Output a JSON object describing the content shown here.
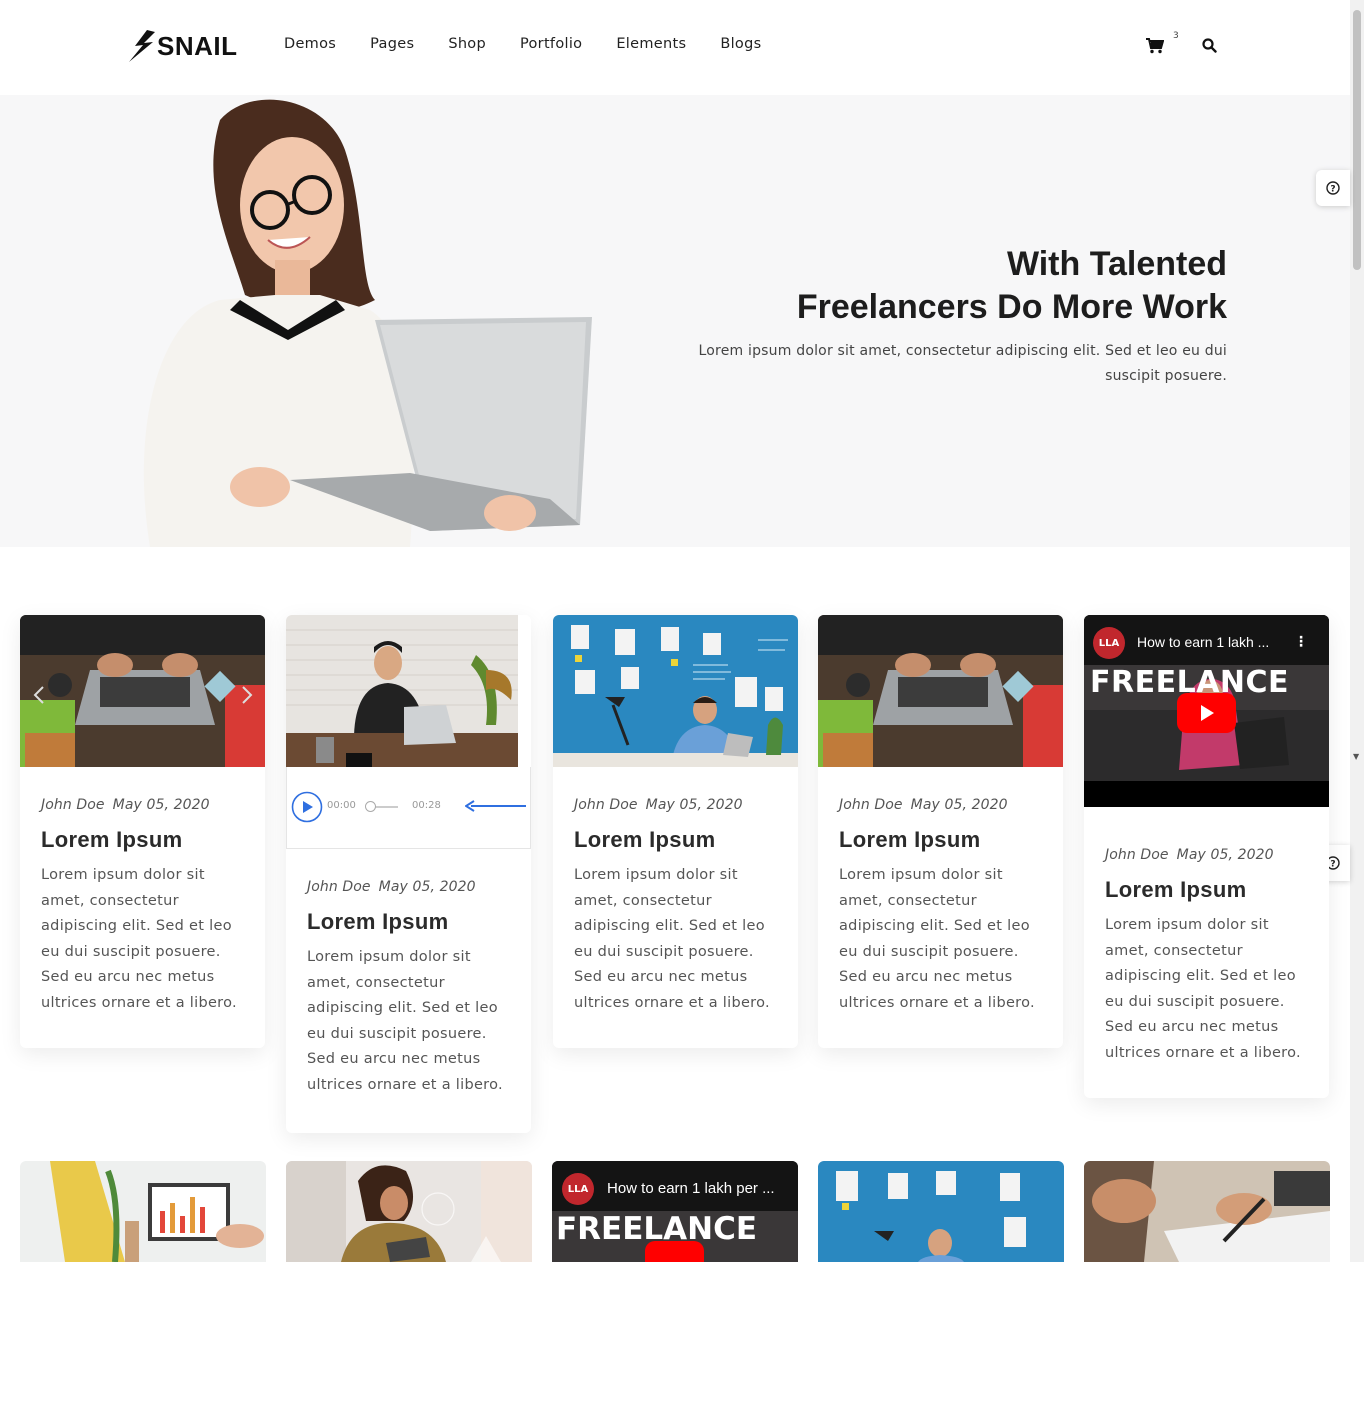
{
  "brand": {
    "logo_text": "SNAIL"
  },
  "nav": {
    "items": [
      {
        "label": "Demos"
      },
      {
        "label": "Pages"
      },
      {
        "label": "Shop"
      },
      {
        "label": "Portfolio"
      },
      {
        "label": "Elements"
      },
      {
        "label": "Blogs"
      }
    ],
    "cart_count": "3"
  },
  "hero": {
    "title_line1": "With Talented",
    "title_line2": "Freelancers Do More Work",
    "text": "Lorem ipsum dolor sit amet, consectetur adipiscing elit. Sed et leo eu dui suscipit posuere."
  },
  "cards": [
    {
      "author": "John Doe",
      "date": "May 05, 2020",
      "title": "Lorem Ipsum",
      "text": "Lorem ipsum dolor sit amet, consectetur adipiscing elit. Sed et leo eu dui suscipit posuere. Sed eu arcu nec metus ultrices ornare et a libero."
    },
    {
      "author": "John Doe",
      "date": "May 05, 2020",
      "title": "Lorem Ipsum",
      "text": "Lorem ipsum dolor sit amet, consectetur adipiscing elit. Sed et leo eu dui suscipit posuere. Sed eu arcu nec metus ultrices ornare et a libero."
    },
    {
      "author": "John Doe",
      "date": "May 05, 2020",
      "title": "Lorem Ipsum",
      "text": "Lorem ipsum dolor sit amet, consectetur adipiscing elit. Sed et leo eu dui suscipit posuere. Sed eu arcu nec metus ultrices ornare et a libero."
    },
    {
      "author": "John Doe",
      "date": "May 05, 2020",
      "title": "Lorem Ipsum",
      "text": "Lorem ipsum dolor sit amet, consectetur adipiscing elit. Sed et leo eu dui suscipit posuere. Sed eu arcu nec metus ultrices ornare et a libero."
    },
    {
      "author": "John Doe",
      "date": "May 05, 2020",
      "title": "Lorem Ipsum",
      "text": "Lorem ipsum dolor sit amet, consectetur adipiscing elit. Sed et leo eu dui suscipit posuere. Sed eu arcu nec metus ultrices ornare et a libero."
    }
  ],
  "audio": {
    "current_time": "00:00",
    "duration": "00:28"
  },
  "video": {
    "title": "How to earn 1 lakh ...",
    "title_row2": "How to earn 1 lakh per ...",
    "channel_badge": "LLA",
    "thumb_text": "FREELANCE"
  },
  "colors": {
    "accent_blue": "#2f6fe0",
    "youtube_red": "#ff0000",
    "hero_bg": "#f7f7f8"
  }
}
